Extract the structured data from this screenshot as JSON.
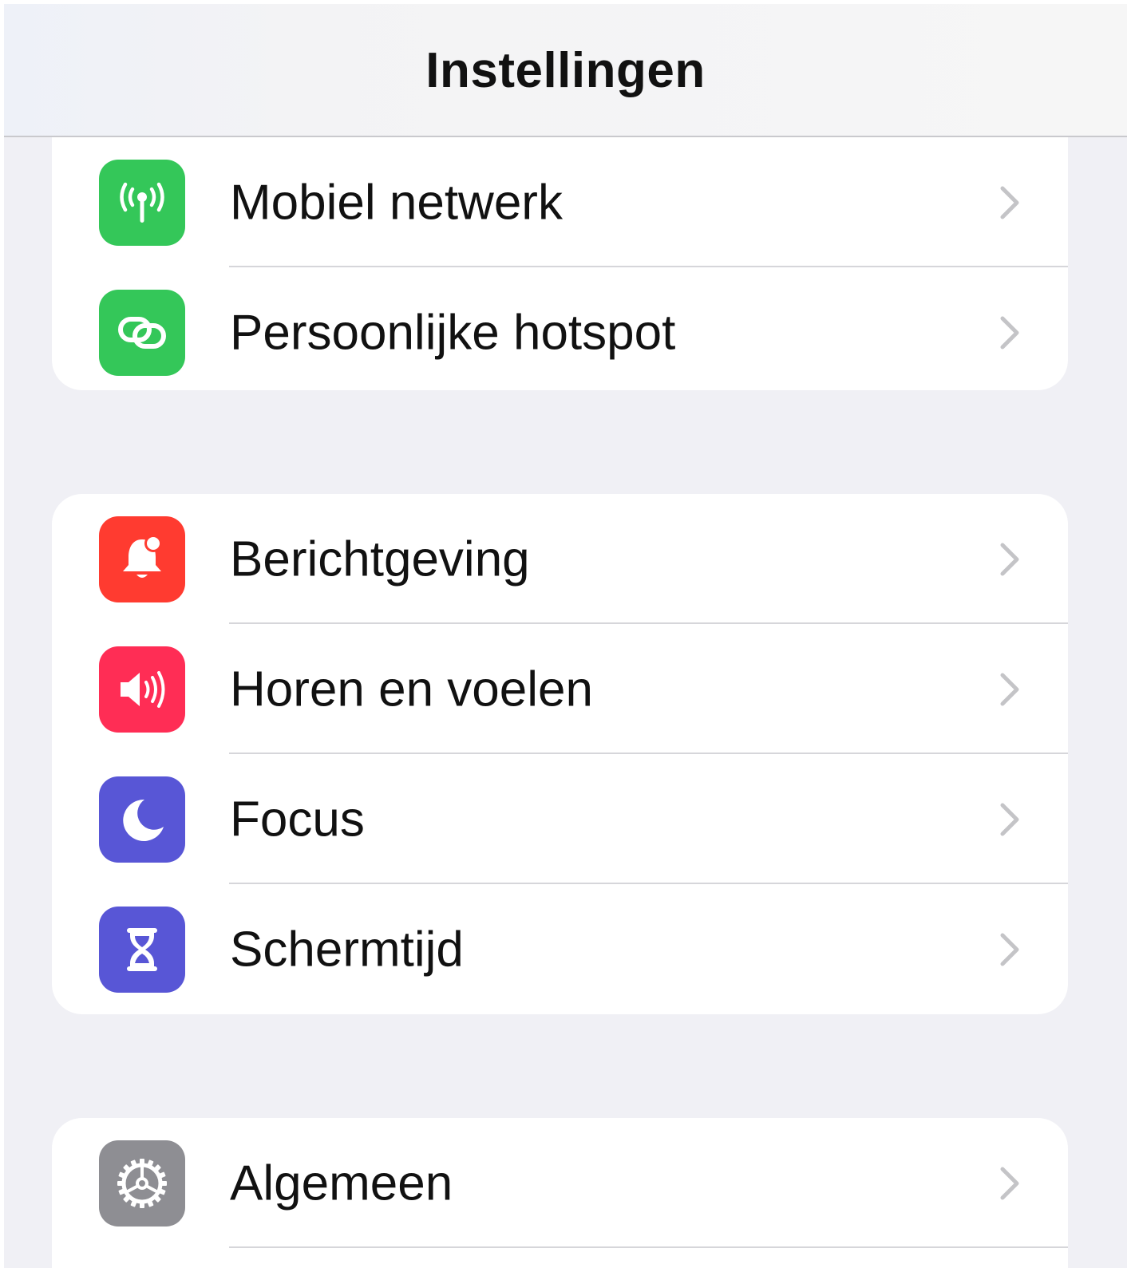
{
  "header": {
    "title": "Instellingen"
  },
  "groups": [
    {
      "items": [
        {
          "label": "Mobiel netwerk",
          "icon": "antenna-icon",
          "color": "#34c759"
        },
        {
          "label": "Persoonlijke hotspot",
          "icon": "hotspot-link-icon",
          "color": "#34c759"
        }
      ]
    },
    {
      "items": [
        {
          "label": "Berichtgeving",
          "icon": "bell-badge-icon",
          "color": "#ff3b30"
        },
        {
          "label": "Horen en voelen",
          "icon": "speaker-icon",
          "color": "#ff2d55"
        },
        {
          "label": "Focus",
          "icon": "moon-icon",
          "color": "#5856d6"
        },
        {
          "label": "Schermtijd",
          "icon": "hourglass-icon",
          "color": "#5856d6"
        }
      ]
    },
    {
      "items": [
        {
          "label": "Algemeen",
          "icon": "gear-icon",
          "color": "#8e8e93"
        }
      ]
    }
  ]
}
